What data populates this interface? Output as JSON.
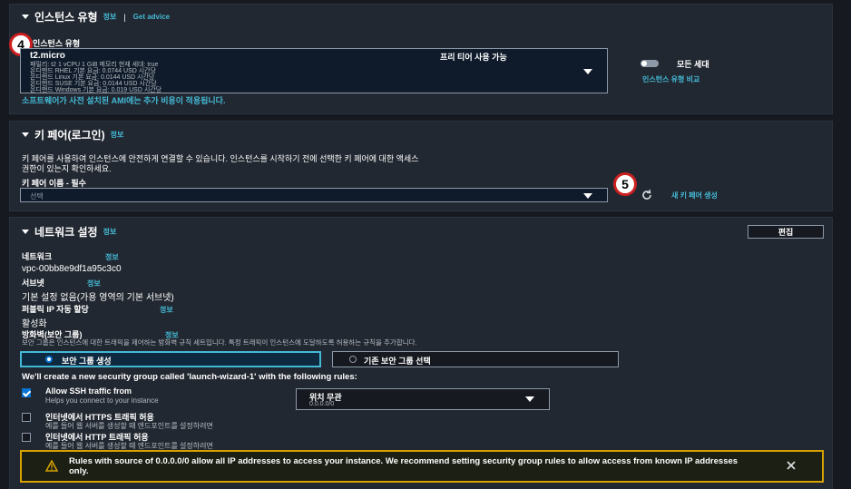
{
  "instance_type": {
    "title": "인스턴스 유형",
    "info": "정보",
    "separator": "|",
    "advice": "Get advice",
    "field_label": "인스턴스 유형",
    "selected": "t2.micro",
    "spec_line": "패밀리: t2    1 vCPU    1 GiB 메모리    현재 세대: true",
    "free_tier": "프리 티어 사용 가능",
    "price_lines": [
      "온디맨드 RHEL 기본 요금: 0.0744 USD 시간당",
      "온디맨드 Linux 기본 요금: 0.0144 USD 시간당",
      "온디맨드 SUSE 기본 요금: 0.0144 USD 시간당",
      "온디맨드 Windows 기본 요금: 0.019 USD 시간당"
    ],
    "ami_note": "소프트웨어가 사전 설치된 AMI에는 추가 비용이 적용됩니다.",
    "all_gen_toggle": "모든 세대",
    "compare_link": "인스턴스 유형 비교",
    "marker": "4"
  },
  "key_pair": {
    "title": "키 페어(로그인)",
    "info": "정보",
    "description_line1": "키 페어를 사용하여 인스턴스에 안전하게 연결할 수 있습니다. 인스턴스를 시작하기 전에 선택한 키 페어에 대한 액세스",
    "description_line2": "권한이 있는지 확인하세요.",
    "field_label": "키 페어 이름 - 필수",
    "placeholder": "선택",
    "create_link": "새 키 페어 생성",
    "marker": "5"
  },
  "network": {
    "title": "네트워크 설정",
    "info": "정보",
    "edit_button": "편집",
    "network_label": "네트워크",
    "network_info": "정보",
    "network_value": "vpc-00bb8e9df1a95c3c0",
    "subnet_label": "서브넷",
    "subnet_info": "정보",
    "subnet_value": "기본 설정 없음(가용 영역의 기본 서브넷)",
    "public_ip_label": "퍼블릭 IP 자동 할당",
    "public_ip_info": "정보",
    "public_ip_value": "활성화",
    "firewall_label": "방화벽(보안 그룹)",
    "firewall_info": "정보",
    "firewall_desc": "보안 그룹은 인스턴스에 대한 트래픽을 제어하는 방화벽 규칙 세트입니다. 특정 트래픽이 인스턴스에 도달하도록 허용하는 규칙을 추가합니다.",
    "create_sg": "보안 그룹 생성",
    "select_sg": "기존 보안 그룹 선택",
    "create_msg": "We'll create a new security group called 'launch-wizard-1' with the following rules:",
    "rules": [
      {
        "label": "Allow SSH traffic from",
        "sub": "Helps you connect to your instance",
        "checked": true
      },
      {
        "label": "인터넷에서 HTTPS 트래픽 허용",
        "sub": "예를 들어 웹 서버를 생성할 때 엔드포인트를 설정하려면",
        "checked": false
      },
      {
        "label": "인터넷에서 HTTP 트래픽 허용",
        "sub": "예를 들어 웹 서버를 생성할 때 엔드포인트를 설정하려면",
        "checked": false
      }
    ],
    "ssh_source": "위치 무관",
    "ssh_source_sub": "0.0.0.0/0",
    "warning": "Rules with source of 0.0.0.0/0 allow all IP addresses to access your instance. We recommend setting security group rules to allow access from known IP addresses only."
  },
  "colors": {
    "accent": "#44b9d6",
    "warning_border": "#d8a200",
    "marker_ring": "#cc1f1f",
    "primary": "#0972d3"
  }
}
